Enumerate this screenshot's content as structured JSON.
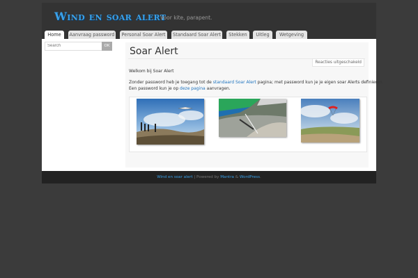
{
  "header": {
    "site_title": "Wind en soar alert",
    "tagline": "Voor kite, parapent."
  },
  "nav": {
    "tabs": [
      {
        "label": "Home",
        "active": true
      },
      {
        "label": "Aanvraag password",
        "active": false
      },
      {
        "label": "Personal Soar Alert",
        "active": false
      },
      {
        "label": "Standaard Soar Alert",
        "active": false
      },
      {
        "label": "Stekken",
        "active": false
      },
      {
        "label": "Uitleg",
        "active": false
      },
      {
        "label": "Wetgeving",
        "active": false
      }
    ]
  },
  "sidebar": {
    "search": {
      "placeholder": "Search",
      "button_label": "OK"
    }
  },
  "main": {
    "title": "Soar Alert",
    "comments_badge": "Reacties uitgeschakeld",
    "intro": "Welkom bij Soar Alert",
    "para1_before": "Zonder password heb je toegang tot de ",
    "para1_link": "standaard Soar Alert",
    "para1_after": " pagina; met password kun je je eigen soar Alerts definieren.",
    "para2_before": "Een password kun je op ",
    "para2_link": "deze pagina",
    "para2_after": " aanvragen."
  },
  "gallery": {
    "images": [
      {
        "icon": "hang-glider-over-dunes-photo"
      },
      {
        "icon": "hang-glider-wing-view-photo"
      },
      {
        "icon": "paraglider-over-dunes-photo"
      }
    ]
  },
  "footer": {
    "site_link": "Wind en soar alert",
    "separator": " | Powered by ",
    "theme_link": "Mantra",
    "amp": " & ",
    "wp_link": "WordPress",
    "end": "."
  },
  "colors": {
    "page_bg": "#3b3b3b",
    "header_bg": "#333333",
    "accent": "#3aa0e8",
    "link": "#1e73be",
    "footer_bg": "#222222"
  }
}
